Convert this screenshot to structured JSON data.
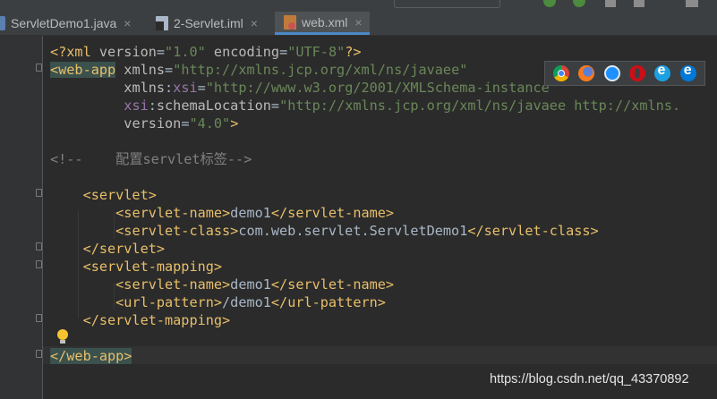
{
  "tabs": [
    {
      "label": "ServletDemo1.java",
      "icon": "java-file-icon",
      "active": false
    },
    {
      "label": "2-Servlet.iml",
      "icon": "iml-file-icon",
      "active": false
    },
    {
      "label": "web.xml",
      "icon": "xml-file-icon",
      "active": true
    }
  ],
  "close_glyph": "×",
  "code": {
    "l1": {
      "a": "<?xml ",
      "b": "version",
      "c": "=",
      "d": "\"1.0\"",
      "e": " ",
      "f": "encoding",
      "g": "=",
      "h": "\"UTF-8\"",
      "i": "?>"
    },
    "l2": {
      "open": "<web-app",
      "attr": " xmlns",
      "eq": "=",
      "val": "\"http://xmlns.jcp.org/xml/ns/javaee\""
    },
    "l3": {
      "pad": "         ",
      "attr": "xmlns",
      "colon": ":",
      "ns": "xsi",
      "eq": "=",
      "val": "\"http://www.w3.org/2001/XMLSchema-instance\""
    },
    "l4": {
      "pad": "         ",
      "ns": "xsi",
      "colon": ":",
      "attr": "schemaLocation",
      "eq": "=",
      "val": "\"http://xmlns.jcp.org/xml/ns/javaee http://xmlns."
    },
    "l5": {
      "pad": "         ",
      "attr": "version",
      "eq": "=",
      "val": "\"4.0\"",
      "close": ">"
    },
    "l6": "<!--    配置servlet标签-->",
    "l7": "    <servlet>",
    "l8": {
      "pad": "        ",
      "o": "<servlet-name>",
      "v": "demo1",
      "c": "</servlet-name>"
    },
    "l9": {
      "pad": "        ",
      "o": "<servlet-class>",
      "v": "com.web.servlet.ServletDemo1",
      "c": "</servlet-class>"
    },
    "l10": "    </servlet>",
    "l11": "    <servlet-mapping>",
    "l12": {
      "pad": "        ",
      "o": "<servlet-name>",
      "v": "demo1",
      "c": "</servlet-name>"
    },
    "l13": {
      "pad": "        ",
      "o": "<url-pattern>",
      "v": "/demo1",
      "c": "</url-pattern>"
    },
    "l14": "    </servlet-mapping>",
    "l15": "</web-app>"
  },
  "browsers": [
    "chrome-icon",
    "firefox-icon",
    "safari-icon",
    "opera-icon",
    "internet-explorer-icon",
    "edge-icon"
  ],
  "watermark": "https://blog.csdn.net/qq_43370892",
  "colors": {
    "background": "#2b2b2b",
    "tag": "#e8bf6a",
    "string": "#6a8759",
    "namespace": "#9876aa",
    "comment": "#808080",
    "text": "#a9b7c6",
    "tab_active_underline": "#4a88c7"
  }
}
